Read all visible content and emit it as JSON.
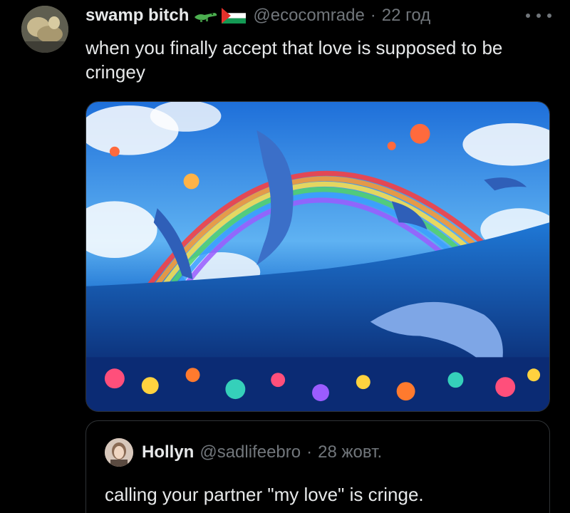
{
  "tweet": {
    "display_name": "swamp bitch",
    "name_emojis": [
      "crocodile-icon",
      "palestine-flag-icon"
    ],
    "handle": "@ecocomrade",
    "separator": "·",
    "time": "22 год",
    "text": "when you finally accept that love is supposed to be cringey",
    "media_description_icon": "dolphins-rainbow-ocean-image"
  },
  "quote": {
    "display_name": "Hollyn",
    "handle": "@sadlifeebro",
    "separator": "·",
    "time": "28 жовт.",
    "text": "calling your partner \"my love\" is cringe."
  },
  "colors": {
    "background": "#000000",
    "primary_text": "#e7e9ea",
    "secondary_text": "#71767b",
    "border": "#2f3336"
  }
}
